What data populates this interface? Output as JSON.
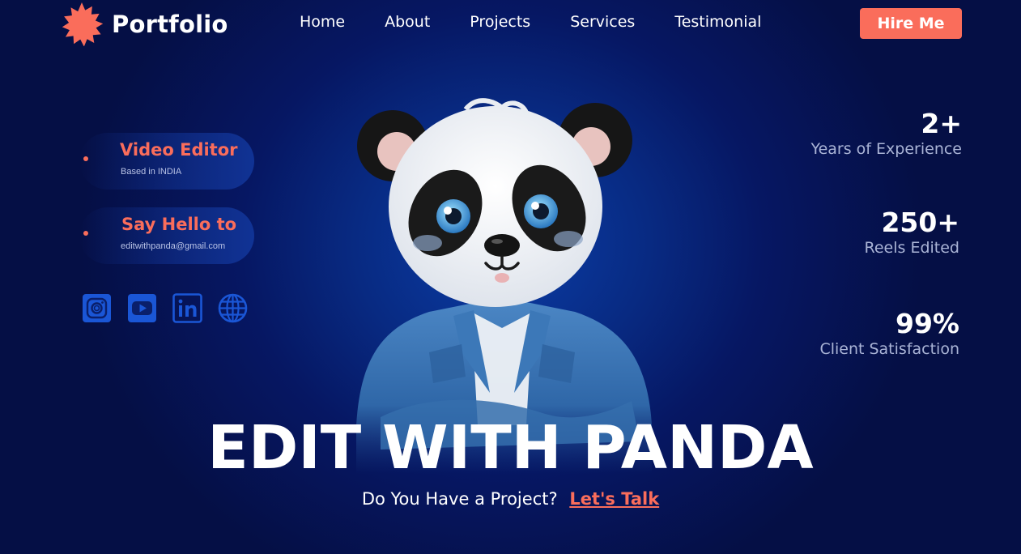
{
  "brand": {
    "name": "Portfolio",
    "accent": "#fa6d5b"
  },
  "nav": {
    "items": [
      {
        "label": "Home"
      },
      {
        "label": "About"
      },
      {
        "label": "Projects"
      },
      {
        "label": "Services"
      },
      {
        "label": "Testimonial"
      }
    ],
    "hire_label": "Hire Me"
  },
  "info": {
    "role": {
      "title": "Video Editor",
      "subtitle": "Based in INDIA"
    },
    "contact": {
      "title": "Say Hello to",
      "subtitle": "editwithpanda@gmail.com"
    }
  },
  "socials": [
    {
      "icon": "instagram-icon"
    },
    {
      "icon": "youtube-icon"
    },
    {
      "icon": "linkedin-icon"
    },
    {
      "icon": "globe-icon"
    }
  ],
  "stats": [
    {
      "value": "2+",
      "label": "Years of Experience"
    },
    {
      "value": "250+",
      "label": "Reels Edited"
    },
    {
      "value": "99%",
      "label": "Client Satisfaction"
    }
  ],
  "hero": {
    "title": "EDIT WITH PANDA",
    "question": "Do You Have a Project?",
    "cta_label": "Let's Talk"
  }
}
